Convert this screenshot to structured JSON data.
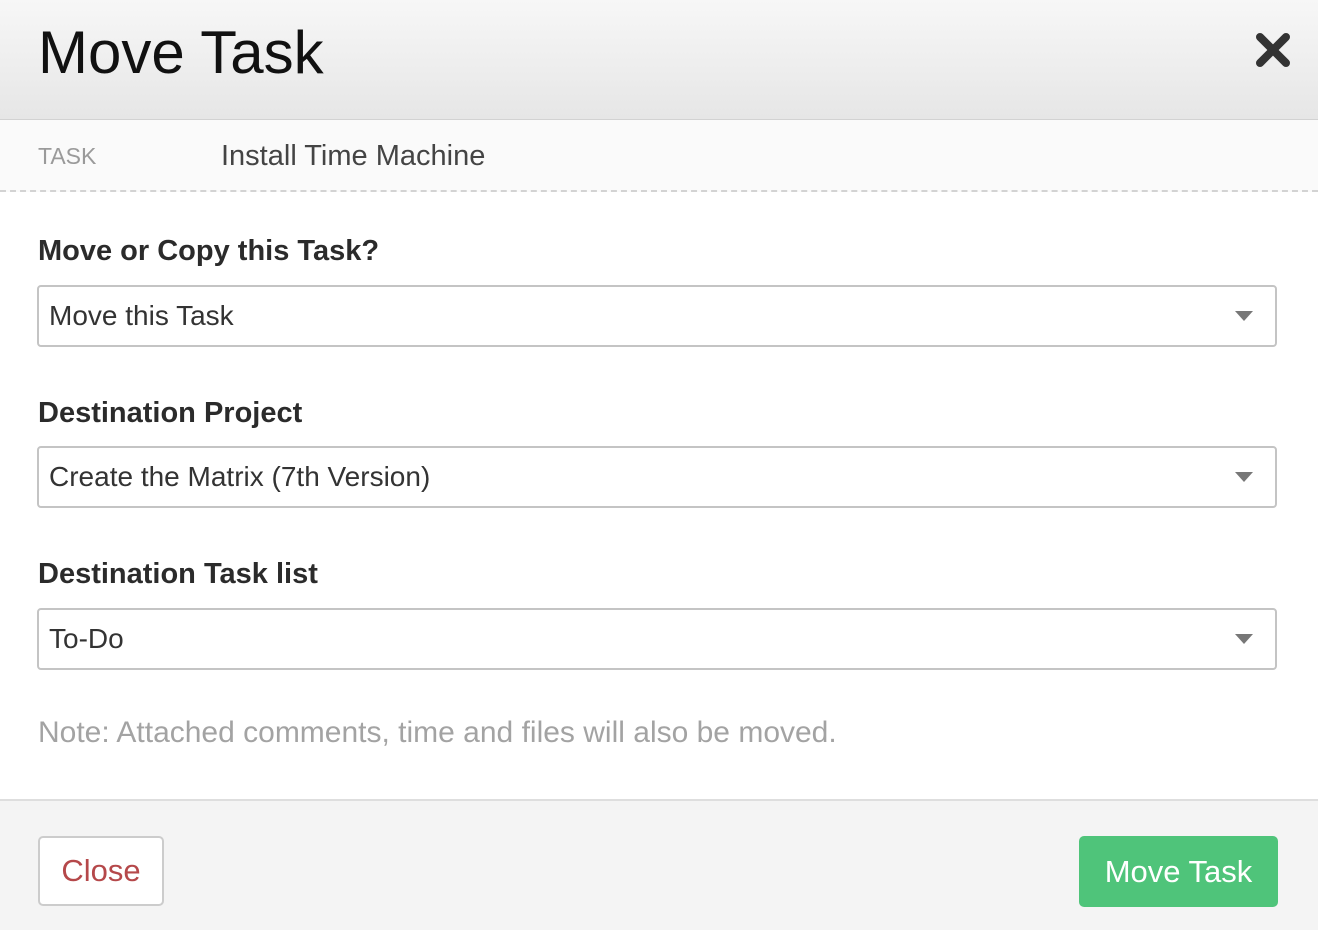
{
  "dialog": {
    "title": "Move Task",
    "close_icon": "close-x-icon"
  },
  "task": {
    "label": "TASK",
    "name": "Install Time Machine"
  },
  "fields": {
    "action": {
      "label": "Move or Copy this Task?",
      "value": "Move this Task"
    },
    "project": {
      "label": "Destination Project",
      "value": "Create the Matrix (7th Version)"
    },
    "task_list": {
      "label": "Destination Task list",
      "value": "To-Do"
    }
  },
  "note": "Note: Attached comments, time and files will also be moved.",
  "footer": {
    "close_label": "Close",
    "submit_label": "Move Task"
  },
  "colors": {
    "primary_button": "#4fc47a",
    "close_text": "#b5484a",
    "note_text": "#a3a3a3"
  }
}
